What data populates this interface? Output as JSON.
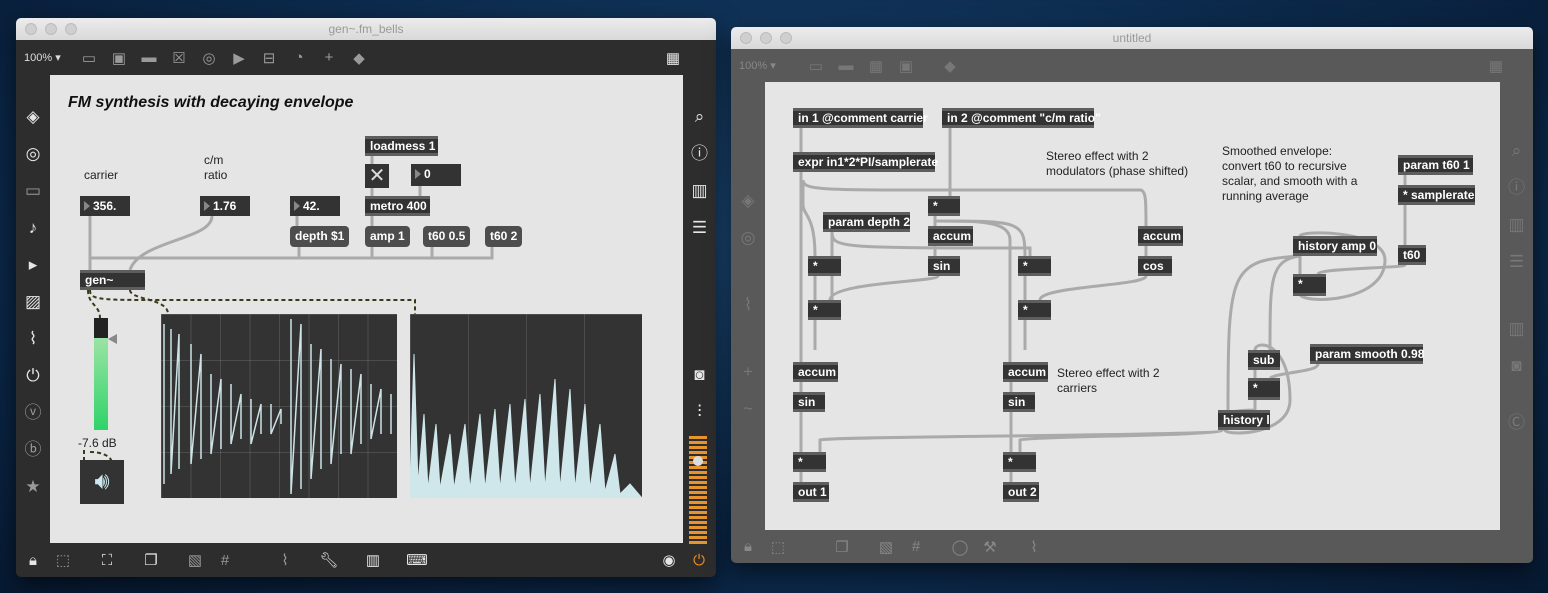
{
  "left_window": {
    "title": "gen~.fm_bells",
    "zoom": "100%",
    "heading": "FM synthesis with decaying envelope",
    "labels": {
      "carrier": "carrier",
      "cm_ratio": "c/m\nratio"
    },
    "numbers": {
      "carrier": "356.",
      "ratio": "1.76",
      "depth": "42.",
      "metro_in": "0"
    },
    "objects": {
      "loadmess": "loadmess 1",
      "metro": "metro 400",
      "gen": "gen~"
    },
    "messages": {
      "depth": "depth $1",
      "amp": "amp 1",
      "t60a": "t60 0.5",
      "t60b": "t60 2"
    },
    "meter_level": "-7.6 dB",
    "toolbar": [
      "presentation-icon",
      "object-icon",
      "comment-icon",
      "toggle-icon",
      "button-icon",
      "play-icon",
      "slider-icon",
      "dial-icon",
      "plus-icon",
      "paint-bucket-icon"
    ],
    "left_sidebar": [
      "cube-icon",
      "target-icon",
      "keyboard-icon",
      "note-icon",
      "play-step-icon",
      "image-icon",
      "paperclip-icon",
      "plug-icon",
      "v-icon",
      "b-icon",
      "star-icon"
    ],
    "right_sidebar": [
      "search-icon",
      "info-icon",
      "book-icon",
      "list-icon",
      "camera-icon",
      "mixer-icon"
    ]
  },
  "right_window": {
    "title": "untitled",
    "zoom": "100%",
    "objects": {
      "in1": "in 1 @comment carrier",
      "in2": "in 2 @comment \"c/m ratio\"",
      "expr": "expr in1*2*PI/samplerate",
      "mul": "*",
      "param_depth": "param depth 2",
      "accum": "accum",
      "sin": "sin",
      "cos": "cos",
      "out1": "out 1",
      "out2": "out 2",
      "param_t60": "param t60 1",
      "mul_sr": "* samplerate",
      "t60": "t60",
      "history_amp": "history amp 0",
      "sub": "sub",
      "param_smooth": "param smooth 0.98",
      "history_l": "history l"
    },
    "comments": {
      "mods": "Stereo effect with 2\nmodulators (phase shifted)",
      "carriers": "Stereo effect with 2\ncarriers",
      "envelope": "Smoothed envelope:\nconvert t60 to recursive\nscalar, and smooth with a\nrunning average"
    }
  },
  "colors": {
    "accent": "#f08a24",
    "meter": "#39d96a",
    "cord": "#aaaaaa"
  }
}
